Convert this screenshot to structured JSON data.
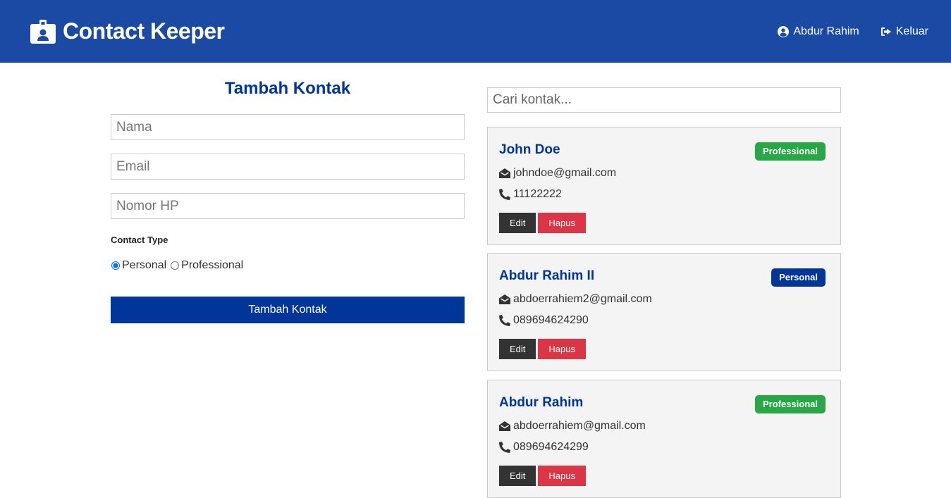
{
  "navbar": {
    "brand_icon": "id-badge-icon",
    "title": "Contact Keeper",
    "user_icon": "user-circle-icon",
    "user_name": "Abdur Rahim",
    "logout_icon": "sign-out-icon",
    "logout_label": "Keluar",
    "background": "#1a4aa4"
  },
  "form": {
    "title": "Tambah Kontak",
    "name_placeholder": "Nama",
    "email_placeholder": "Email",
    "phone_placeholder": "Nomor HP",
    "type_label": "Contact Type",
    "radio_personal": "Personal",
    "radio_professional": "Professional",
    "selected_type": "Personal",
    "submit_label": "Tambah Kontak",
    "accent": "#003699"
  },
  "search": {
    "placeholder": "Cari kontak..."
  },
  "contacts": [
    {
      "name": "John Doe",
      "type": "Professional",
      "email": "johndoe@gmail.com",
      "phone": "11122222",
      "edit_label": "Edit",
      "delete_label": "Hapus"
    },
    {
      "name": "Abdur Rahim II",
      "type": "Personal",
      "email": "abdoerrahiem2@gmail.com",
      "phone": "089694624290",
      "edit_label": "Edit",
      "delete_label": "Hapus"
    },
    {
      "name": "Abdur Rahim",
      "type": "Professional",
      "email": "abdoerrahiem@gmail.com",
      "phone": "089694624299",
      "edit_label": "Edit",
      "delete_label": "Hapus"
    }
  ],
  "colors": {
    "professional_badge": "#28a745",
    "personal_badge": "#003699",
    "delete_button": "#dc3545",
    "edit_button": "#333333"
  }
}
